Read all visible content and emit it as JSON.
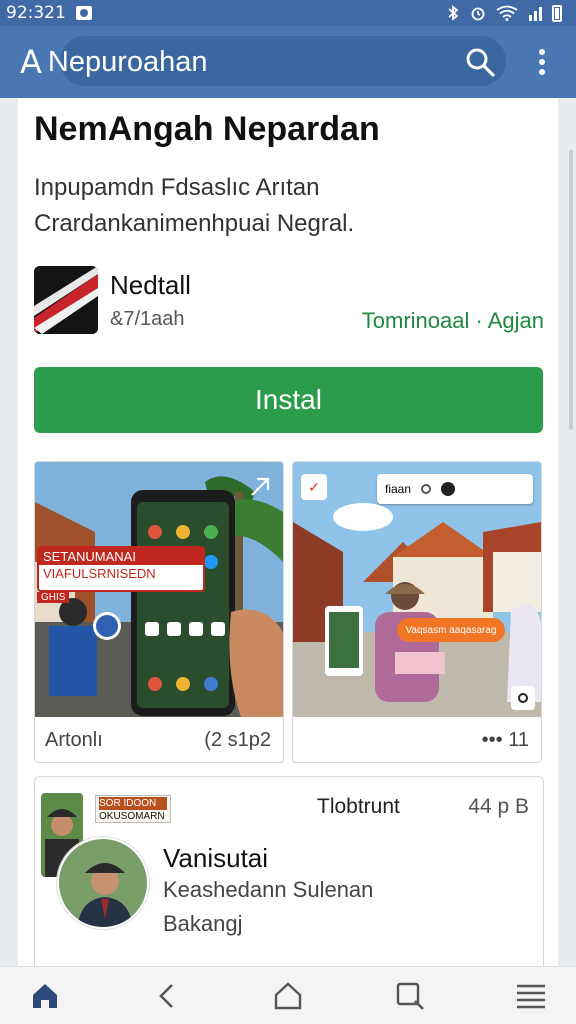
{
  "status_bar": {
    "time": "92:321",
    "icons": [
      "notification-icon",
      "bluetooth-icon",
      "alarm-icon",
      "wifi-icon",
      "signal-icon",
      "battery-icon"
    ]
  },
  "app_bar": {
    "logo": "A",
    "title": "Nepuroahan",
    "search_icon": "search-icon",
    "menu_icon": "more-vert-icon"
  },
  "page": {
    "title": "NemAngah Nepardan",
    "description_1": "Inpupamdn Fdsaslıc Arıtan",
    "description_2": "Crardankanimenhpuai Negral."
  },
  "app": {
    "name": "Nedtall",
    "size": "&7/1aah",
    "developer": "Tomrinoaal · Agjan",
    "install_label": "Instal"
  },
  "screenshots": [
    {
      "banner_1": "SETANUMANAI",
      "banner_2": "VIAFULSRNISEDN",
      "banner_3": "GHIS",
      "caption": "Artonlı",
      "meta": "(2 s1p2"
    },
    {
      "toolbar_text": "fiaan",
      "overlay": "Vaqsasm aaqasarag",
      "caption": "",
      "meta": "••• 11"
    }
  ],
  "review": {
    "badge_1": "SOR IDOON",
    "badge_2": "OKUSOMARN",
    "label": "Tlobtrunt",
    "time": "44 p B",
    "name": "Vanisutai",
    "line_1": "Keashedann Sulenan",
    "line_2": "Bakangj"
  },
  "colors": {
    "app_bar": "#4a76b3",
    "status_bar": "#3f6aa6",
    "install": "#2a9c4b",
    "developer": "#1e8a3d"
  },
  "nav": [
    "home-filled-icon",
    "back-icon",
    "home-icon",
    "recents-icon",
    "menu-icon"
  ]
}
